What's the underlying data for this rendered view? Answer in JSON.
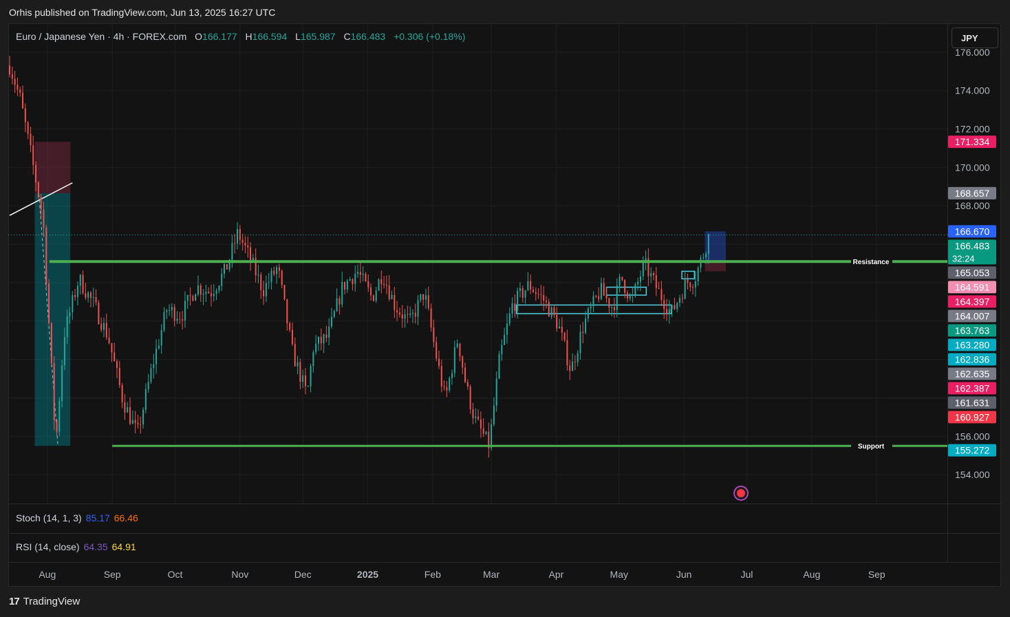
{
  "publisher_line": "Orhis published on TradingView.com, Jun 13, 2025 16:27 UTC",
  "symbol": {
    "title": "Euro / Japanese Yen · 4h · FOREX.com",
    "open_label": "O",
    "open": "166.177",
    "high_label": "H",
    "high": "166.594",
    "low_label": "L",
    "low": "165.987",
    "close_label": "C",
    "close": "166.483",
    "change": "+0.306 (+0.18%)"
  },
  "currency_button": "JPY",
  "indicators": {
    "stoch": {
      "label": "Stoch (14, 1, 3)",
      "k": "85.17",
      "d": "66.46"
    },
    "rsi": {
      "label": "RSI (14, close)",
      "rsi": "64.35",
      "ma": "64.91"
    }
  },
  "footer_brand": "TradingView",
  "colors": {
    "bull": "#26a69a",
    "bear": "#ef5350",
    "level_line": "#4caf50",
    "box_cyan": "#4dd0e1",
    "stoch_k": "#2962ff",
    "stoch_d": "#ff6d00",
    "rsi": "#7e57c2",
    "rsi_ma": "#fdd835"
  },
  "chart_data": {
    "type": "candlestick",
    "ylim": [
      152.5,
      177.5
    ],
    "y_ticks": [
      "176.000",
      "174.000",
      "172.000",
      "170.000",
      "168.000",
      "156.000",
      "154.000"
    ],
    "x_ticks": [
      "Aug",
      "Sep",
      "Oct",
      "Nov",
      "Dec",
      "2025",
      "Feb",
      "Mar",
      "Apr",
      "May",
      "Jun",
      "Jul",
      "Aug",
      "Sep"
    ],
    "price_path": [
      [
        "2024-07-14",
        175.3
      ],
      [
        "2024-07-19",
        173.6
      ],
      [
        "2024-07-25",
        170.2
      ],
      [
        "2024-07-30",
        167.3
      ],
      [
        "2024-08-05",
        155.5
      ],
      [
        "2024-08-09",
        161.3
      ],
      [
        "2024-08-16",
        164.2
      ],
      [
        "2024-08-23",
        162.9
      ],
      [
        "2024-08-30",
        161.2
      ],
      [
        "2024-09-06",
        157.9
      ],
      [
        "2024-09-13",
        156.1
      ],
      [
        "2024-09-20",
        159.6
      ],
      [
        "2024-09-27",
        162.6
      ],
      [
        "2024-10-04",
        162.3
      ],
      [
        "2024-10-11",
        163.8
      ],
      [
        "2024-10-18",
        163.5
      ],
      [
        "2024-10-25",
        164.6
      ],
      [
        "2024-10-31",
        166.6
      ],
      [
        "2024-11-06",
        165.2
      ],
      [
        "2024-11-12",
        163.6
      ],
      [
        "2024-11-19",
        164.8
      ],
      [
        "2024-11-26",
        160.4
      ],
      [
        "2024-12-03",
        158.1
      ],
      [
        "2024-12-06",
        160.6
      ],
      [
        "2024-12-13",
        161.2
      ],
      [
        "2024-12-20",
        163.8
      ],
      [
        "2024-12-27",
        164.6
      ],
      [
        "2025-01-03",
        163.2
      ],
      [
        "2025-01-08",
        164.5
      ],
      [
        "2025-01-14",
        162.8
      ],
      [
        "2025-01-21",
        161.9
      ],
      [
        "2025-01-28",
        163.5
      ],
      [
        "2025-02-03",
        160.0
      ],
      [
        "2025-02-07",
        157.9
      ],
      [
        "2025-02-13",
        161.1
      ],
      [
        "2025-02-17",
        158.6
      ],
      [
        "2025-02-21",
        156.9
      ],
      [
        "2025-02-28",
        155.5
      ],
      [
        "2025-03-05",
        160.1
      ],
      [
        "2025-03-11",
        162.8
      ],
      [
        "2025-03-19",
        163.9
      ],
      [
        "2025-03-26",
        163.1
      ],
      [
        "2025-04-02",
        161.8
      ],
      [
        "2025-04-08",
        159.4
      ],
      [
        "2025-04-14",
        161.8
      ],
      [
        "2025-04-22",
        163.6
      ],
      [
        "2025-04-28",
        162.7
      ],
      [
        "2025-05-02",
        164.3
      ],
      [
        "2025-05-07",
        163.0
      ],
      [
        "2025-05-13",
        165.0
      ],
      [
        "2025-05-20",
        163.5
      ],
      [
        "2025-05-26",
        162.4
      ],
      [
        "2025-06-02",
        164.0
      ],
      [
        "2025-06-06",
        164.2
      ],
      [
        "2025-06-10",
        165.4
      ],
      [
        "2025-06-13",
        166.483
      ]
    ],
    "levels": [
      {
        "name": "Resistance",
        "value": 165.1,
        "label": "Resistance",
        "from": "2024-08-02"
      },
      {
        "name": "Support",
        "value": 155.5,
        "label": "Support",
        "from": "2024-09-01"
      }
    ],
    "boxes": [
      {
        "kind": "short-stop-zone",
        "from": "2024-07-26",
        "to": "2024-08-12",
        "top": 171.334,
        "bottom": 168.657
      },
      {
        "kind": "short-target-zone",
        "from": "2024-07-26",
        "to": "2024-08-12",
        "top": 168.657,
        "bottom": 155.5
      },
      {
        "kind": "demand-box",
        "from": "2025-03-13",
        "to": "2025-05-26",
        "top": 162.836,
        "bottom": 162.387
      },
      {
        "kind": "demand-box",
        "from": "2025-04-25",
        "to": "2025-05-14",
        "top": 163.763,
        "bottom": 163.35
      },
      {
        "kind": "demand-box",
        "from": "2025-05-31",
        "to": "2025-06-06",
        "top": 164.591,
        "bottom": 164.2
      },
      {
        "kind": "long-target-zone",
        "from": "2025-06-11",
        "to": "2025-06-21",
        "top": 166.67,
        "bottom": 165.053
      },
      {
        "kind": "long-stop-zone",
        "from": "2025-06-11",
        "to": "2025-06-21",
        "top": 165.053,
        "bottom": 164.591
      }
    ],
    "price_tags": [
      {
        "value": "171.334",
        "color": "#e91e63"
      },
      {
        "value": "168.657",
        "color": "#787b86"
      },
      {
        "value": "166.670",
        "color": "#2962ff"
      },
      {
        "value": "166.483",
        "color": "#089981",
        "countdown": "32:24"
      },
      {
        "value": "165.053",
        "color": "#5d606b"
      },
      {
        "value": "164.591",
        "color": "#f48fb1"
      },
      {
        "value": "164.397",
        "color": "#e91e63"
      },
      {
        "value": "164.007",
        "color": "#787b86"
      },
      {
        "value": "163.763",
        "color": "#089981"
      },
      {
        "value": "163.280",
        "color": "#00acc1"
      },
      {
        "value": "162.836",
        "color": "#00acc1"
      },
      {
        "value": "162.635",
        "color": "#787b86"
      },
      {
        "value": "162.387",
        "color": "#e91e63"
      },
      {
        "value": "161.631",
        "color": "#5d606b"
      },
      {
        "value": "160.927",
        "color": "#f23645"
      },
      {
        "value": "155.272",
        "color": "#00acc1"
      }
    ]
  }
}
